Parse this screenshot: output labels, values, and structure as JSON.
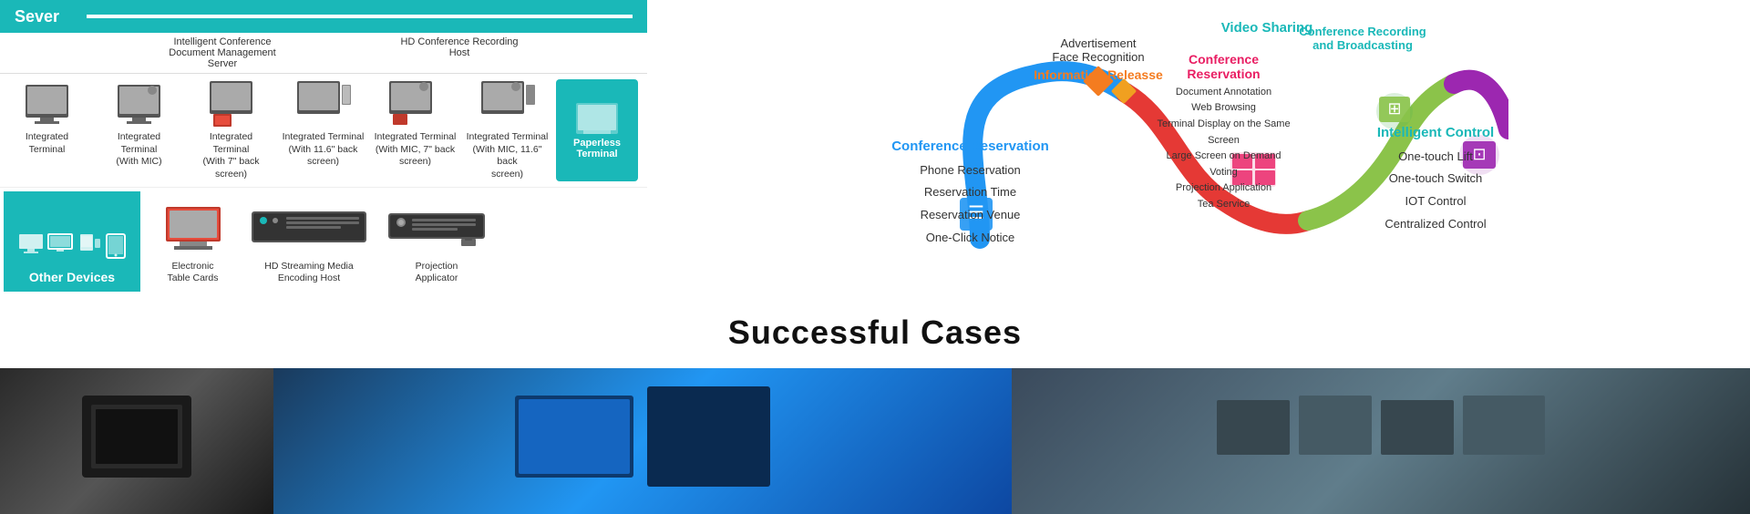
{
  "header": {
    "server_label": "Sever"
  },
  "devices_top": [
    {
      "label": "Integrated\nTerminal"
    },
    {
      "label": "Integrated\nTerminal\n(With MIC)"
    },
    {
      "label": "Integrated\nTerminal\n(With 7\" back\nscreen)"
    },
    {
      "label": "Integrated Terminal\n(With 11.6\" back\nscreen)"
    },
    {
      "label": "Integrated Terminal\n(With MIC, 7\" back\nscreen)"
    },
    {
      "label": "Integrated Terminal\n(With MIC, 11.6\" back\nscreen)"
    },
    {
      "label": "Paperless\nTerminal",
      "highlight": true
    }
  ],
  "devices_bottom_left": {
    "label": "Other Devices"
  },
  "devices_bottom": [
    {
      "label": "Electronic\nTable Cards"
    },
    {
      "label": "HD Streaming Media\nEncoding Host"
    },
    {
      "label": "Projection\nApplicator"
    }
  ],
  "top_labels": [
    {
      "text": "Intelligent Conference\nDocument Management\nServer"
    },
    {
      "text": "HD Conference Recording\nHost"
    }
  ],
  "diagram": {
    "conf_reservation": {
      "title": "Conference Reservation",
      "items": [
        "Phone Reservation",
        "Reservation Time",
        "Reservation Venue",
        "One-Click Notice"
      ]
    },
    "info_release": {
      "title": "Information Releasse",
      "sub_items": [
        "Advertisement",
        "Face Recognition"
      ]
    },
    "conf_reservation_center": {
      "title": "Conference\nReservation",
      "items": [
        "Document Annotation",
        "Web Browsing",
        "Terminal Display on the Same Screen",
        "Large Screen on Demand",
        "Voting",
        "Projection Application",
        "Tea Service"
      ]
    },
    "conf_recording": {
      "title": "Conference Recording\nand Broadcasting"
    },
    "video_sharing": {
      "title": "Video Sharing"
    },
    "intelligent_control": {
      "title": "Intelligent Control",
      "items": [
        "One-touch Lift",
        "One-touch Switch",
        "IOT Control",
        "Centralized Control"
      ]
    }
  },
  "successful_cases": {
    "title": "Successful Cases"
  },
  "colors": {
    "teal": "#1ab8b8",
    "blue": "#2196f3",
    "orange": "#f47c20",
    "pink": "#e91e63",
    "green": "#4caf50",
    "purple": "#9c27b0",
    "red": "#e53935"
  }
}
